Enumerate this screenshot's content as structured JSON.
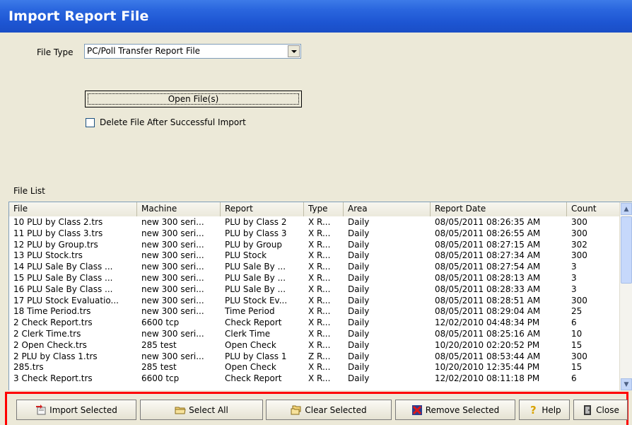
{
  "window": {
    "title": "Import Report File"
  },
  "form": {
    "file_type_label": "File Type",
    "file_type_value": "PC/Poll Transfer Report File",
    "open_button": "Open File(s)",
    "delete_checkbox_label": "Delete File After Successful Import",
    "delete_checked": false
  },
  "file_list": {
    "label": "File List",
    "columns": [
      "File",
      "Machine",
      "Report",
      "Type",
      "Area",
      "Report Date",
      "Count"
    ],
    "rows": [
      [
        "10 PLU by Class 2.trs",
        "new 300 seri...",
        "PLU by Class 2",
        "X R...",
        "Daily",
        "08/05/2011 08:26:35 AM",
        "300"
      ],
      [
        "11 PLU by Class 3.trs",
        "new 300 seri...",
        "PLU by Class 3",
        "X R...",
        "Daily",
        "08/05/2011 08:26:55 AM",
        "300"
      ],
      [
        "12 PLU by Group.trs",
        "new 300 seri...",
        "PLU by Group",
        "X R...",
        "Daily",
        "08/05/2011 08:27:15 AM",
        "302"
      ],
      [
        "13 PLU Stock.trs",
        "new 300 seri...",
        "PLU Stock",
        "X R...",
        "Daily",
        "08/05/2011 08:27:34 AM",
        "300"
      ],
      [
        "14 PLU Sale By Class ...",
        "new 300 seri...",
        "PLU Sale By ...",
        "X R...",
        "Daily",
        "08/05/2011 08:27:54 AM",
        "3"
      ],
      [
        "15 PLU Sale By Class ...",
        "new 300 seri...",
        "PLU Sale By ...",
        "X R...",
        "Daily",
        "08/05/2011 08:28:13 AM",
        "3"
      ],
      [
        "16 PLU Sale By Class ...",
        "new 300 seri...",
        "PLU Sale By ...",
        "X R...",
        "Daily",
        "08/05/2011 08:28:33 AM",
        "3"
      ],
      [
        "17 PLU Stock Evaluatio...",
        "new 300 seri...",
        "PLU Stock Ev...",
        "X R...",
        "Daily",
        "08/05/2011 08:28:51 AM",
        "300"
      ],
      [
        "18 Time Period.trs",
        "new 300 seri...",
        "Time Period",
        "X R...",
        "Daily",
        "08/05/2011 08:29:04 AM",
        "25"
      ],
      [
        "2 Check Report.trs",
        "6600 tcp",
        "Check Report",
        "X R...",
        "Daily",
        "12/02/2010 04:48:34 PM",
        "6"
      ],
      [
        "2 Clerk Time.trs",
        "new 300 seri...",
        "Clerk Time",
        "X R...",
        "Daily",
        "08/05/2011 08:25:16 AM",
        "10"
      ],
      [
        "2 Open Check.trs",
        "285 test",
        "Open Check",
        "X R...",
        "Daily",
        "10/20/2010 02:20:52 PM",
        "15"
      ],
      [
        "2 PLU by Class 1.trs",
        "new 300 seri...",
        "PLU by Class 1",
        "Z R...",
        "Daily",
        "08/05/2011 08:53:44 AM",
        "300"
      ],
      [
        "285.trs",
        "285 test",
        "Open Check",
        "X R...",
        "Daily",
        "10/20/2010 12:35:44 PM",
        "15"
      ],
      [
        "3 Check Report.trs",
        "6600 tcp",
        "Check Report",
        "X R...",
        "Daily",
        "12/02/2010 08:11:18 PM",
        "6"
      ]
    ]
  },
  "buttons": {
    "import_selected": "Import Selected",
    "select_all": "Select All",
    "clear_selected": "Clear Selected",
    "remove_selected": "Remove Selected",
    "help": "Help",
    "close": "Close"
  },
  "icons": {
    "import": "import-icon",
    "select_all": "folder-icon",
    "clear": "folders-icon",
    "remove": "red-x-icon",
    "help": "question-icon",
    "close": "close-door-icon"
  },
  "colors": {
    "title_bar": "#2a66de",
    "highlight_frame": "#ff0000",
    "dialog_bg": "#ece9d8"
  }
}
